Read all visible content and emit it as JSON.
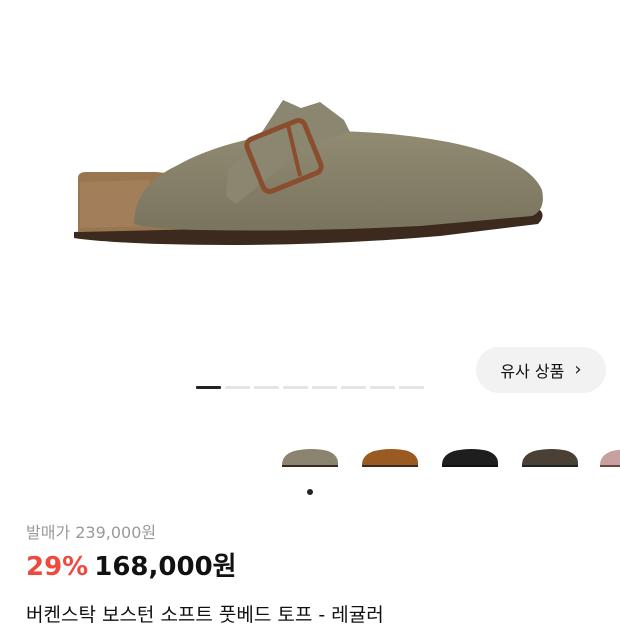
{
  "product": {
    "original_price": "발매가 239,000원",
    "discount": "29%",
    "price": "168,000원",
    "title": "버켄스탁 보스턴 소프트 풋베드 토프 - 레귤러"
  },
  "similar_button": {
    "label": "유사 상품",
    "icon": "chevron-right-icon"
  },
  "gallery": {
    "total_images": 8,
    "current_index": 1
  },
  "color_options": [
    {
      "name": "taupe",
      "color": "#8a8470"
    },
    {
      "name": "tobacco",
      "color": "#9a5b22"
    },
    {
      "name": "black",
      "color": "#1e1e1e"
    },
    {
      "name": "mocha",
      "color": "#4a4036"
    },
    {
      "name": "pink",
      "color": "#c9a0a0"
    }
  ],
  "colors": {
    "discount": "#f0493e",
    "muted": "#9a9a9a"
  }
}
